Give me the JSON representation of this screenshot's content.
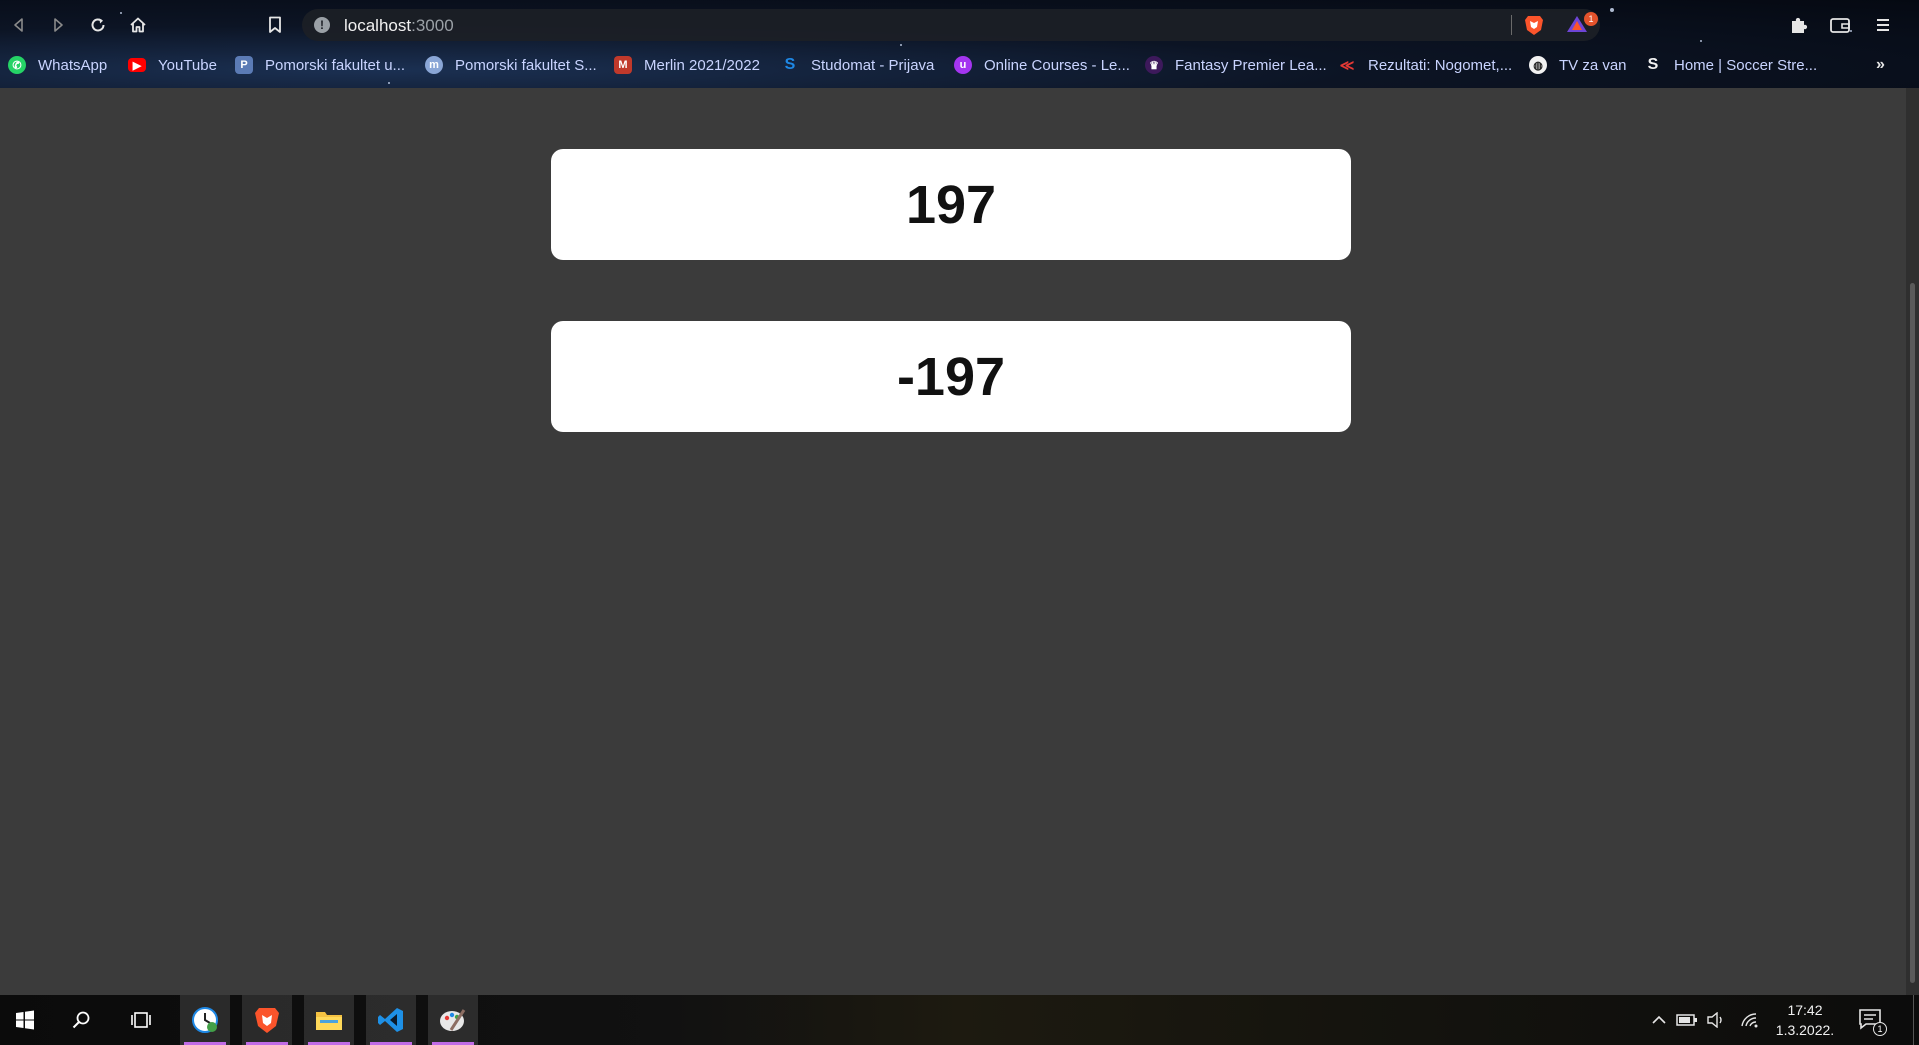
{
  "browser": {
    "address": {
      "host": "localhost",
      "port": ":3000"
    },
    "rewards_badge": "1",
    "bookmarks": [
      {
        "label": "WhatsApp",
        "icon": "whatsapp-icon",
        "color": "#25d366"
      },
      {
        "label": "YouTube",
        "icon": "youtube-icon",
        "color": "#ff0000"
      },
      {
        "label": "Pomorski fakultet u...",
        "icon": "pomorski-icon",
        "color": "#5b7bb5"
      },
      {
        "label": "Pomorski fakultet S...",
        "icon": "moodle-icon",
        "color": "#8aa6d6"
      },
      {
        "label": "Merlin 2021/2022",
        "icon": "merlin-icon",
        "color": "#c0392b"
      },
      {
        "label": "Studomat - Prijava",
        "icon": "studomat-icon",
        "color": "#1e88e5"
      },
      {
        "label": "Online Courses - Le...",
        "icon": "udemy-icon",
        "color": "#a435f0"
      },
      {
        "label": "Fantasy Premier Lea...",
        "icon": "premier-league-icon",
        "color": "#3d195b"
      },
      {
        "label": "Rezultati: Nogomet,...",
        "icon": "rezultati-icon",
        "color": "#b71c1c"
      },
      {
        "label": "TV za van",
        "icon": "globe-icon",
        "color": "#ffffff"
      },
      {
        "label": "Home | Soccer Stre...",
        "icon": "soccer-streams-icon",
        "color": "#ffffff"
      }
    ],
    "more_bookmarks": "»"
  },
  "page": {
    "card1_value": "197",
    "card2_value": "-197"
  },
  "taskbar": {
    "time": "17:42",
    "date": "1.3.2022.",
    "notification_count": "1",
    "pinned": [
      {
        "name": "clock-app-icon",
        "active": true
      },
      {
        "name": "brave-browser-icon",
        "active": true
      },
      {
        "name": "file-explorer-icon",
        "active": true
      },
      {
        "name": "vscode-icon",
        "active": true
      },
      {
        "name": "paint-icon",
        "active": true
      }
    ]
  }
}
